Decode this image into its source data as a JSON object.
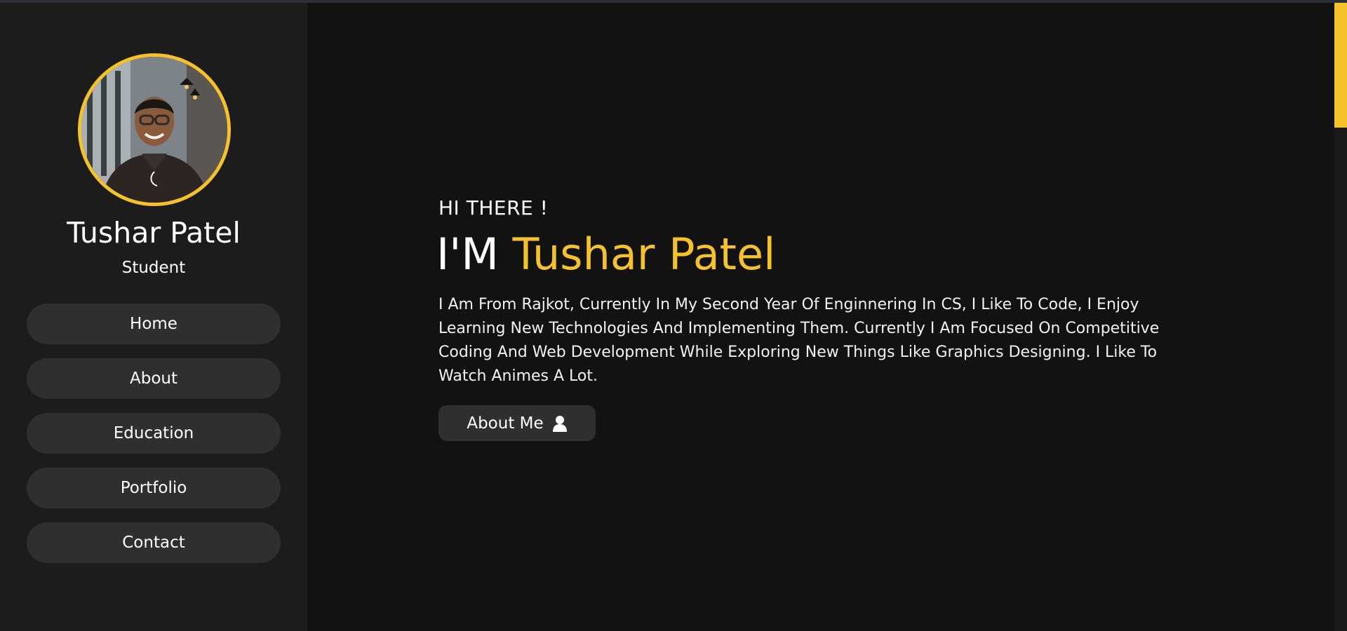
{
  "sidebar": {
    "name": "Tushar Patel",
    "role": "Student",
    "nav": [
      {
        "label": "Home"
      },
      {
        "label": "About"
      },
      {
        "label": "Education"
      },
      {
        "label": "Portfolio"
      },
      {
        "label": "Contact"
      }
    ]
  },
  "hero": {
    "greeting": "HI THERE !",
    "prefix": "I'M",
    "name": "Tushar Patel",
    "bio": "I Am From Rajkot, Currently In My Second Year Of Enginnering In CS, I Like To Code, I Enjoy Learning New Technologies And Implementing Them. Currently I Am Focused On Competitive Coding And Web Development While Exploring New Things Like Graphics Designing. I Like To Watch Animes A Lot.",
    "button_label": "About Me",
    "button_icon": "user-icon"
  },
  "colors": {
    "accent": "#f5c22b",
    "background": "#121212",
    "sidebar": "#1c1c1c",
    "button": "#2f2f2f"
  }
}
